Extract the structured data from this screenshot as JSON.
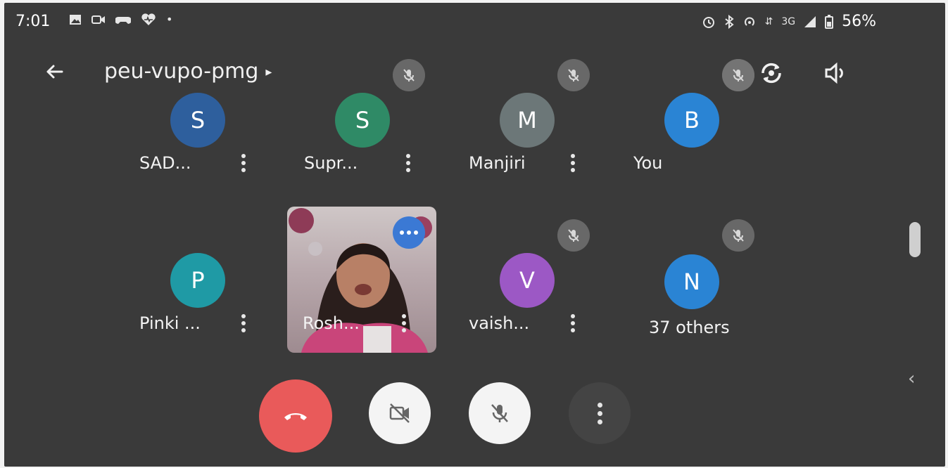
{
  "status_bar": {
    "time": "7:01",
    "network": "3G",
    "battery": "56%"
  },
  "app_bar": {
    "meeting_code": "peu-vupo-pmg"
  },
  "participants": [
    {
      "initial": "S",
      "name": "SAD...",
      "avatar_color": "#2e5f9d"
    },
    {
      "initial": "S",
      "name": "Supr...",
      "avatar_color": "#2f8a66"
    },
    {
      "initial": "M",
      "name": "Manjiri",
      "avatar_color": "#6c7778"
    },
    {
      "initial": "B",
      "name": "You",
      "avatar_color": "#2a84d4"
    },
    {
      "initial": "P",
      "name": "Pinki ...",
      "avatar_color": "#1f9aa5"
    },
    {
      "initial": "",
      "name": "Rosh...",
      "avatar_color": ""
    },
    {
      "initial": "V",
      "name": "vaish...",
      "avatar_color": "#9c58c5"
    },
    {
      "initial": "N",
      "name": "37 others",
      "avatar_color": "#2a84d4"
    }
  ],
  "colors": {
    "background": "#3a3a3a",
    "end_call": "#e95a5a",
    "more_badge": "#3b79d4"
  }
}
